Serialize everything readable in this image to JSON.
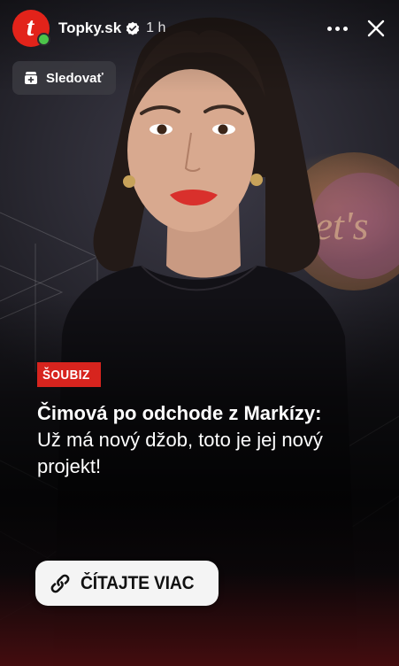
{
  "story": {
    "account": {
      "name": "Topky.sk",
      "avatar_letter": "t",
      "verified": true,
      "time_ago": "1 h"
    },
    "follow_button": {
      "label": "Sledovať"
    },
    "article": {
      "category": "ŠOUBIZ",
      "headline_bold": "Čimová po odchode z Markízy:",
      "headline_rest": " Už má nový džob, toto je jej nový projekt!"
    },
    "cta": {
      "label": "ČÍTAJTE VIAC"
    },
    "icons": {
      "verified": "verified-badge-icon",
      "more": "more-options-icon",
      "close": "close-icon",
      "follow": "add-follow-icon",
      "link": "link-icon"
    },
    "colors": {
      "brand_red": "#e2231a",
      "badge_red": "#d7241e",
      "online_green": "#4cc44a",
      "cta_background": "#f4f4f4"
    }
  }
}
